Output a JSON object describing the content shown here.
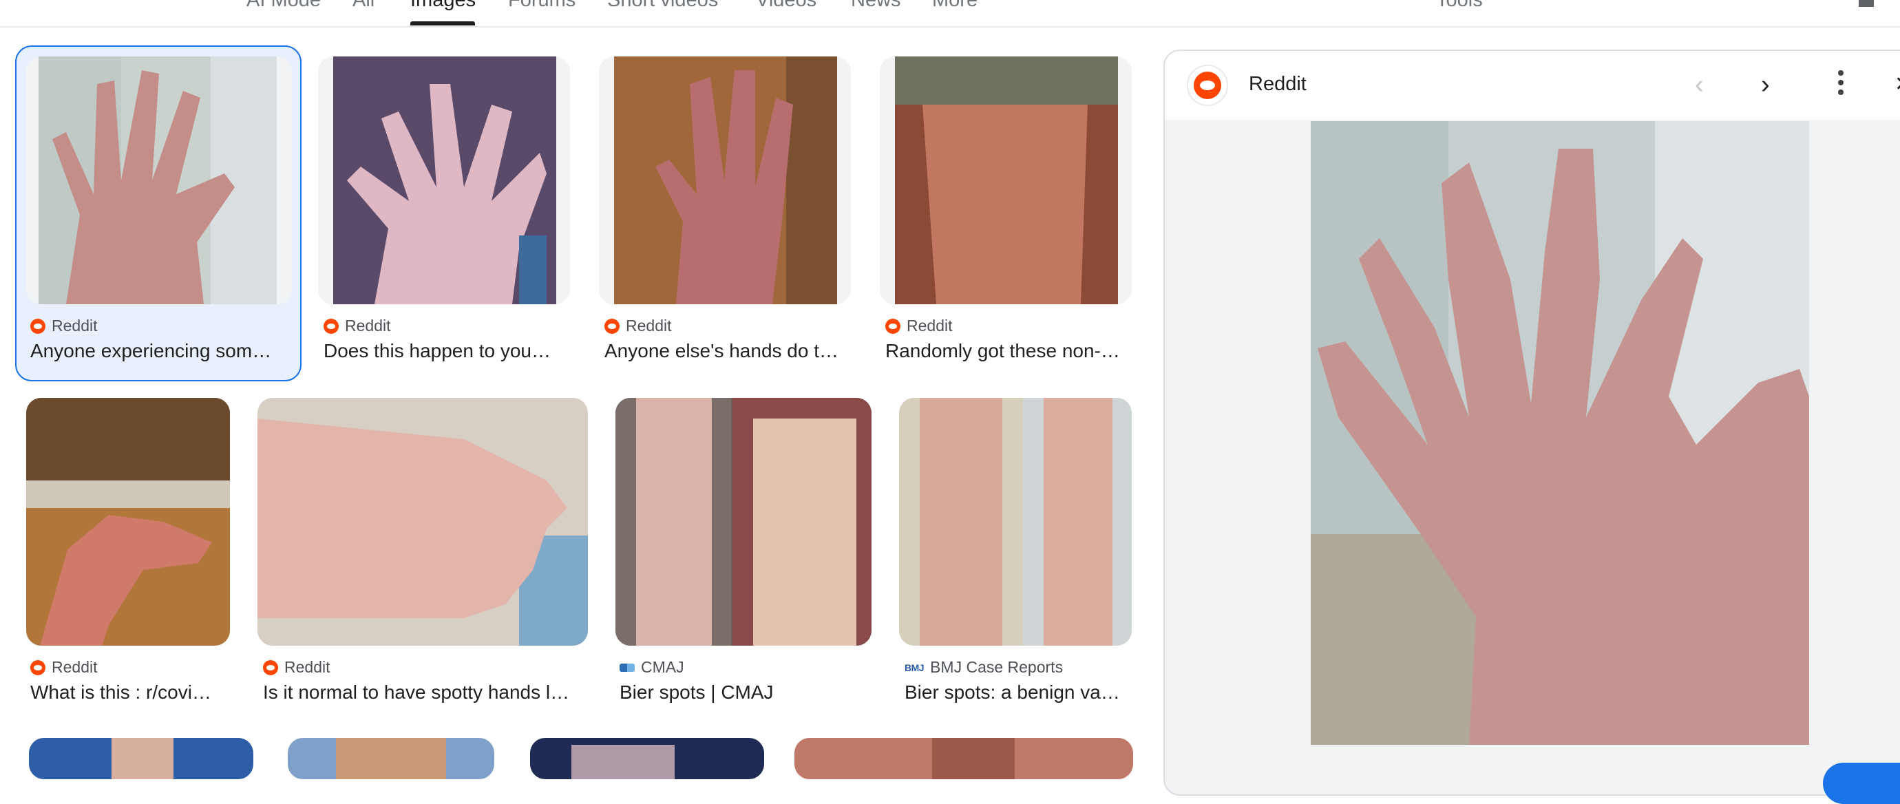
{
  "nav": {
    "tabs": [
      "AI Mode",
      "All",
      "Images",
      "Forums",
      "Short videos",
      "Videos",
      "News",
      "More"
    ],
    "active_tab": "Images",
    "tools_label": "Tools"
  },
  "results": [
    {
      "source": "Reddit",
      "source_icon": "reddit-icon",
      "title": "Anyone experiencing som…",
      "selected": true
    },
    {
      "source": "Reddit",
      "source_icon": "reddit-icon",
      "title": "Does this happen to you…"
    },
    {
      "source": "Reddit",
      "source_icon": "reddit-icon",
      "title": "Anyone else's hands do t…"
    },
    {
      "source": "Reddit",
      "source_icon": "reddit-icon",
      "title": "Randomly got these non-…"
    },
    {
      "source": "Reddit",
      "source_icon": "reddit-icon",
      "title": "What is this : r/covi…"
    },
    {
      "source": "Reddit",
      "source_icon": "reddit-icon",
      "title": "Is it normal to have spotty hands l…"
    },
    {
      "source": "CMAJ",
      "source_icon": "cmaj-icon",
      "title": "Bier spots | CMAJ"
    },
    {
      "source": "BMJ Case Reports",
      "source_icon": "bmj-icon",
      "title": "Bier spots: a benign va…"
    }
  ],
  "preview": {
    "source": "Reddit",
    "prev_icon": "chevron-left-icon",
    "next_icon": "chevron-right-icon",
    "more_icon": "more-vert-icon",
    "close_icon": "close-icon"
  },
  "colors": {
    "selected_bg": "#e8f0fe",
    "selected_border": "#1a73e8",
    "reddit": "#ff4500",
    "text_primary": "#1f1f1f",
    "text_secondary": "#4d5156"
  }
}
